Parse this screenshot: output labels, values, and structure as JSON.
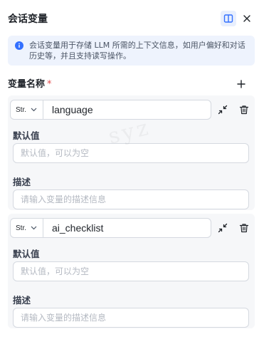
{
  "header": {
    "title": "会话变量"
  },
  "info": {
    "text": "会话变量用于存储 LLM 所需的上下文信息，如用户偏好和对话历史等，并且支持读写操作。"
  },
  "section": {
    "label": "变量名称",
    "required_mark": "*"
  },
  "variables": [
    {
      "type": "Str.",
      "name": "language",
      "default_label": "默认值",
      "default_placeholder": "默认值，可以为空",
      "desc_label": "描述",
      "desc_placeholder": "请输入变量的描述信息"
    },
    {
      "type": "Str.",
      "name": "ai_checklist",
      "default_label": "默认值",
      "default_placeholder": "默认值，可以为空",
      "desc_label": "描述",
      "desc_placeholder": "请输入变量的描述信息"
    }
  ],
  "watermark": "syz",
  "colors": {
    "accent": "#3370ff",
    "info_bg": "#eef3fd",
    "card_bg": "#f6f7f9",
    "required": "#e24b4b"
  }
}
